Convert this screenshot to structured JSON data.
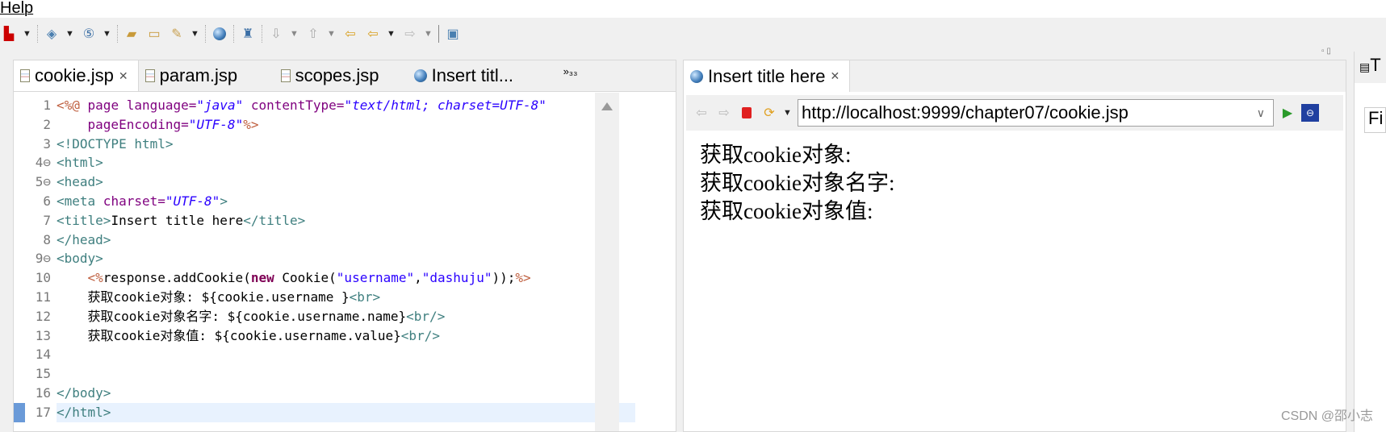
{
  "menu": {
    "help": "Help"
  },
  "editor": {
    "tabs": [
      {
        "label": "cookie.jsp",
        "active": true
      },
      {
        "label": "param.jsp"
      },
      {
        "label": "scopes.jsp"
      },
      {
        "label": "Insert titl..."
      }
    ],
    "overflow": "»₃₃",
    "lines": [
      {
        "n": "1"
      },
      {
        "n": "2"
      },
      {
        "n": "3"
      },
      {
        "n": "4⊖"
      },
      {
        "n": "5⊖"
      },
      {
        "n": "6"
      },
      {
        "n": "7"
      },
      {
        "n": "8"
      },
      {
        "n": "9⊖"
      },
      {
        "n": "10"
      },
      {
        "n": "11"
      },
      {
        "n": "12"
      },
      {
        "n": "13"
      },
      {
        "n": "14"
      },
      {
        "n": "15"
      },
      {
        "n": "16"
      },
      {
        "n": "17"
      }
    ],
    "code": {
      "l1": [
        "<%@",
        " page",
        " language=",
        "\"java\"",
        " contentType=",
        "\"text/html; charset=UTF-8\""
      ],
      "l2": [
        "    pageEncoding=",
        "\"UTF-8\"",
        "%>"
      ],
      "l3": "<!DOCTYPE html>",
      "l4": "<html>",
      "l5": "<head>",
      "l6": [
        "<meta",
        " charset=",
        "\"UTF-8\"",
        ">"
      ],
      "l7": [
        "<title>",
        "Insert title here",
        "</title>"
      ],
      "l8": "</head>",
      "l9": "<body>",
      "l10": [
        "    <%",
        "response.addCookie(",
        "new",
        " Cookie(",
        "\"username\"",
        ",",
        "\"dashuju\"",
        "));",
        "%>"
      ],
      "l11": [
        "    获取cookie对象: ${cookie.username }",
        "<br>"
      ],
      "l12": [
        "    获取cookie对象名字: ${cookie.username.name}",
        "<br/>"
      ],
      "l13": [
        "    获取cookie对象值: ${cookie.username.value}",
        "<br/>"
      ],
      "l16": "</body>",
      "l17": "</html>"
    }
  },
  "browser": {
    "tab": "Insert title here",
    "url": "http://localhost:9999/chapter07/cookie.jsp",
    "content": [
      "获取cookie对象:",
      "获取cookie对象名字:",
      "获取cookie对象值:"
    ]
  },
  "right_panel": {
    "title": "T",
    "find": "Fi"
  },
  "watermark": "CSDN @邵小志"
}
